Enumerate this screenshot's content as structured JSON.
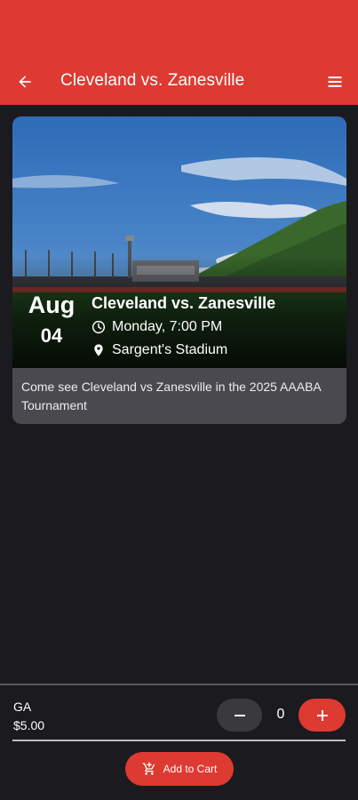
{
  "header": {
    "title": "Cleveland vs. Zanesville",
    "back_icon": "arrow-left-icon",
    "menu_icon": "hamburger-menu-icon",
    "color": "#dd3a31"
  },
  "event": {
    "month": "Aug",
    "day": "04",
    "name": "Cleveland vs. Zanesville",
    "time": "Monday, 7:00 PM",
    "venue": "Sargent's Stadium",
    "description": "Come see Cleveland vs Zanesville in the 2025 AAABA Tournament"
  },
  "ticket": {
    "name": "GA",
    "price": "$5.00",
    "quantity": "0",
    "minus_label": "−",
    "plus_label": "+"
  },
  "cart": {
    "label": "Add to Cart"
  }
}
